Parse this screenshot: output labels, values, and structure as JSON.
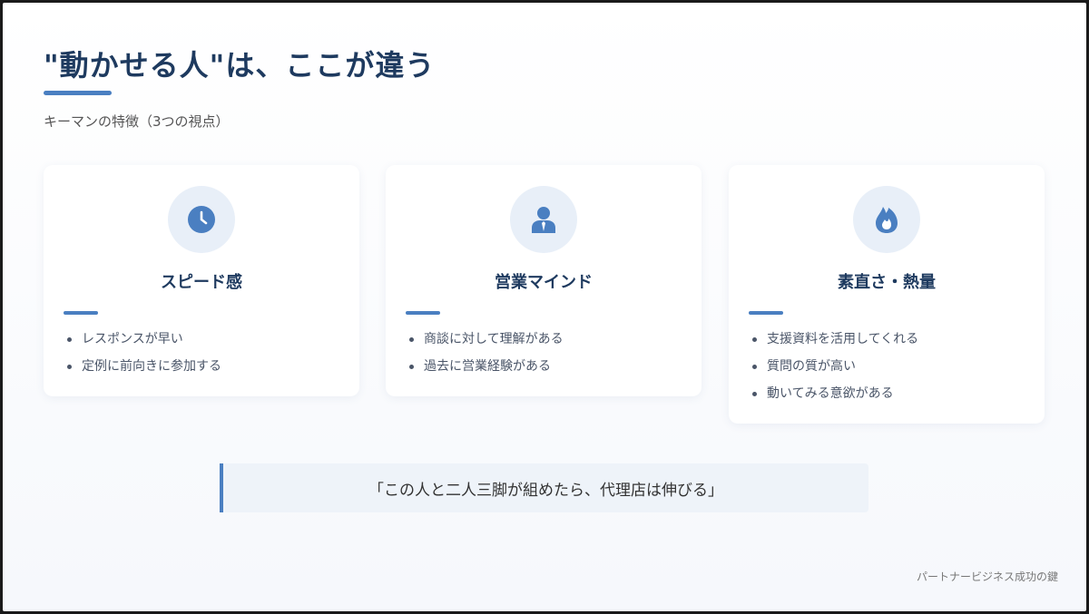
{
  "title": "\"動かせる人\"は、ここが違う",
  "subtitle": "キーマンの特徴（3つの視点）",
  "cards": [
    {
      "icon": "clock-icon",
      "title": "スピード感",
      "items": [
        "レスポンスが早い",
        "定例に前向きに参加する"
      ]
    },
    {
      "icon": "person-icon",
      "title": "営業マインド",
      "items": [
        "商談に対して理解がある",
        "過去に営業経験がある"
      ]
    },
    {
      "icon": "fire-icon",
      "title": "素直さ・熱量",
      "items": [
        "支援資料を活用してくれる",
        "質問の質が高い",
        "動いてみる意欲がある"
      ]
    }
  ],
  "quote": "「この人と二人三脚が組めたら、代理店は伸びる」",
  "footer": "パートナービジネス成功の鍵",
  "colors": {
    "accent": "#4a7fc1",
    "heading": "#1e3a5f"
  }
}
